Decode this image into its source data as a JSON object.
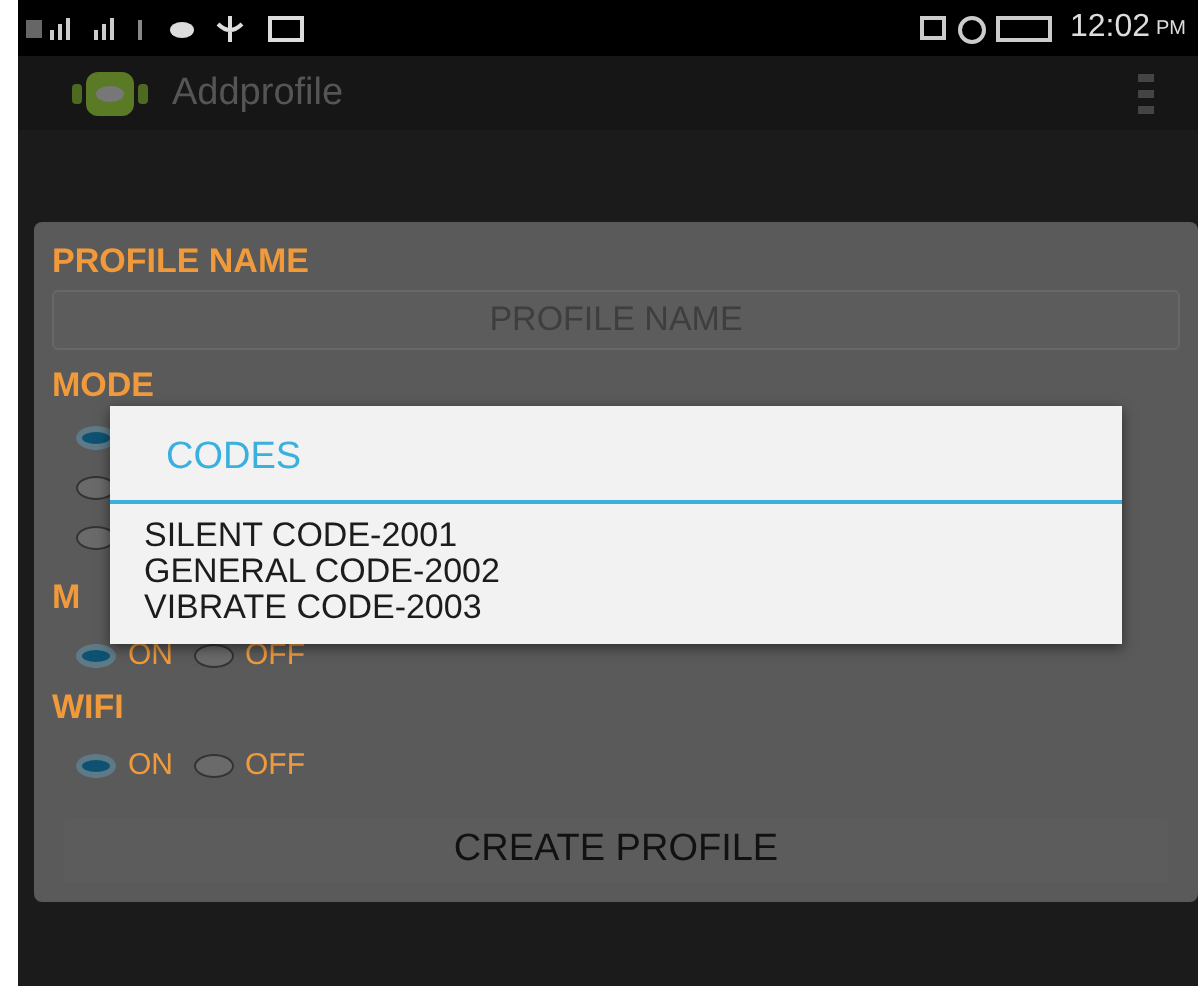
{
  "status_bar": {
    "time": "12:02",
    "meridiem": "PM"
  },
  "action_bar": {
    "title": "Addprofile"
  },
  "form": {
    "name_label": "PROFILE NAME",
    "name_field": {
      "placeholder": "PROFILE NAME"
    },
    "mode": {
      "label": "MODE",
      "options": [
        {
          "selected": true
        },
        {
          "selected": false
        },
        {
          "selected": false
        }
      ]
    },
    "groups": [
      {
        "label": "M",
        "options": [
          {
            "label": "ON",
            "selected": true
          },
          {
            "label": "OFF",
            "selected": false
          }
        ]
      },
      {
        "label": "WIFI",
        "options": [
          {
            "label": "ON",
            "selected": true
          },
          {
            "label": "OFF",
            "selected": false
          }
        ]
      }
    ],
    "submit": "CREATE PROFILE"
  },
  "dialog": {
    "title": "CODES",
    "lines": [
      "SILENT CODE-2001",
      "GENERAL CODE-2002",
      "VIBRATE CODE-2003"
    ]
  }
}
